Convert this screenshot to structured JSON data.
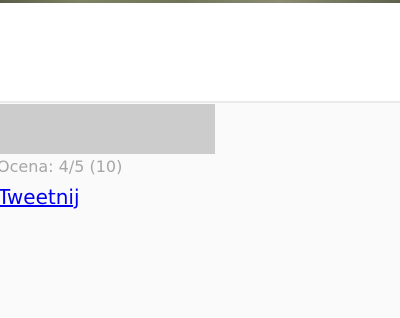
{
  "rating": {
    "text": "Ocena: 4/5 (10)"
  },
  "share": {
    "tweet_label": "Tweetnij"
  }
}
